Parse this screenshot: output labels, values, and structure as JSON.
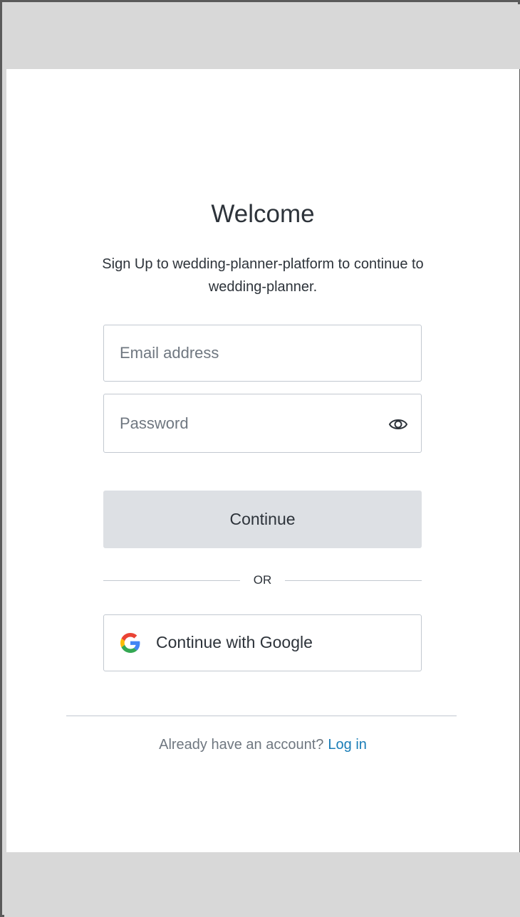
{
  "page": {
    "title": "Welcome",
    "subtitle": "Sign Up to wedding-planner-platform to continue to wedding-planner."
  },
  "form": {
    "email_placeholder": "Email address",
    "email_value": "",
    "password_placeholder": "Password",
    "password_value": "",
    "password_toggle_icon": "eye-icon",
    "continue_label": "Continue"
  },
  "divider": {
    "label": "OR"
  },
  "social": {
    "google_label": "Continue with Google",
    "google_icon": "google-logo-icon"
  },
  "footer": {
    "prompt": "Already have an account?",
    "login_label": "Log in"
  },
  "colors": {
    "text": "#2d333a",
    "muted": "#6f7780",
    "link": "#1a7db7",
    "border": "#c2c8d0",
    "button_bg": "#dde0e4",
    "backdrop": "#d8d8d8"
  }
}
